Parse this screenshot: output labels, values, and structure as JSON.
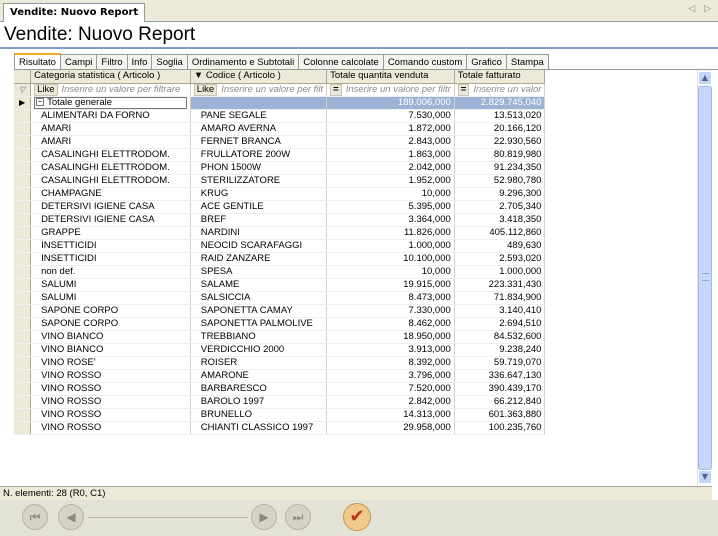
{
  "doc_tab": {
    "label": "Vendite: Nuovo Report",
    "nav": "◁ ▷"
  },
  "title": "Vendite: Nuovo Report",
  "tabs": [
    "Risultato",
    "Campi",
    "Filtro",
    "Info",
    "Soglia",
    "Ordinamento e Subtotali",
    "Colonne calcolate",
    "Comando custom",
    "Grafico",
    "Stampa"
  ],
  "active_tab": "Risultato",
  "grid": {
    "columns": [
      "Categoria statistica  ( Articolo )",
      "Codice  ( Articolo )",
      "Totale quantita venduta",
      "Totale fatturato"
    ],
    "sort_indicator": "▼",
    "filter": {
      "like_label": "Like",
      "eq_label": "=",
      "placeholder_1": "Inserire un valore per filtrare",
      "placeholder_2": "Inserire un valore per filt",
      "placeholder_3": "Inserire un valore per filtr",
      "placeholder_4": "Inserire un valor"
    },
    "total": {
      "label": "Totale generale",
      "qty": "189.006,000",
      "revenue": "2.829.745,040",
      "toggle": "−"
    },
    "rows": [
      [
        "ALIMENTARI DA FORNO",
        "PANE SEGALE",
        "7.530,000",
        "13.513,020"
      ],
      [
        "AMARI",
        "AMARO AVERNA",
        "1.872,000",
        "20.166,120"
      ],
      [
        "AMARI",
        "FERNET BRANCA",
        "2.843,000",
        "22.930,560"
      ],
      [
        "CASALINGHI ELETTRODOM.",
        "FRULLATORE 200W",
        "1.863,000",
        "80.819,980"
      ],
      [
        "CASALINGHI ELETTRODOM.",
        "PHON 1500W",
        "2.042,000",
        "91.234,350"
      ],
      [
        "CASALINGHI ELETTRODOM.",
        "STERILIZZATORE",
        "1.952,000",
        "52.980,780"
      ],
      [
        "CHAMPAGNE",
        "KRUG",
        "10,000",
        "9.296,300"
      ],
      [
        "DETERSIVI IGIENE CASA",
        "ACE GENTILE",
        "5.395,000",
        "2.705,340"
      ],
      [
        "DETERSIVI IGIENE CASA",
        "BREF",
        "3.364,000",
        "3.418,350"
      ],
      [
        "GRAPPE",
        "NARDINI",
        "11.826,000",
        "405.112,860"
      ],
      [
        "INSETTICIDI",
        "NEOCID SCARAFAGGI",
        "1.000,000",
        "489,630"
      ],
      [
        "INSETTICIDI",
        "RAID ZANZARE",
        "10.100,000",
        "2.593,020"
      ],
      [
        "non def.",
        "SPESA",
        "10,000",
        "1.000,000"
      ],
      [
        "SALUMI",
        "SALAME",
        "19.915,000",
        "223.331,430"
      ],
      [
        "SALUMI",
        "SALSICCIA",
        "8.473,000",
        "71.834,900"
      ],
      [
        "SAPONE CORPO",
        "SAPONETTA CAMAY",
        "7.330,000",
        "3.140,410"
      ],
      [
        "SAPONE CORPO",
        "SAPONETTA PALMOLIVE",
        "8.462,000",
        "2.694,510"
      ],
      [
        "VINO BIANCO",
        "TREBBIANO",
        "18.950,000",
        "84.532,600"
      ],
      [
        "VINO BIANCO",
        "VERDICCHIO 2000",
        "3.913,000",
        "9.238,240"
      ],
      [
        "VINO ROSE'",
        "ROISER",
        "8.392,000",
        "59.719,070"
      ],
      [
        "VINO ROSSO",
        "AMARONE",
        "3.796,000",
        "336.647,130"
      ],
      [
        "VINO ROSSO",
        "BARBARESCO",
        "7.520,000",
        "390.439,170"
      ],
      [
        "VINO ROSSO",
        "BAROLO 1997",
        "2.842,000",
        "66.212,840"
      ],
      [
        "VINO ROSSO",
        "BRUNELLO",
        "14.313,000",
        "601.363,880"
      ],
      [
        "VINO ROSSO",
        "CHIANTI CLASSICO 1997",
        "29.958,000",
        "100.235,760"
      ]
    ]
  },
  "status": "N. elementi: 28 (R0, C1)",
  "nav_icons": {
    "first": "first-icon",
    "prev": "prev-icon",
    "next": "next-icon",
    "last": "last-icon",
    "confirm": "check-icon"
  },
  "colors": {
    "accent": "#f5a623",
    "selection": "#9db3d6",
    "title_rule": "#7a9cc8"
  }
}
